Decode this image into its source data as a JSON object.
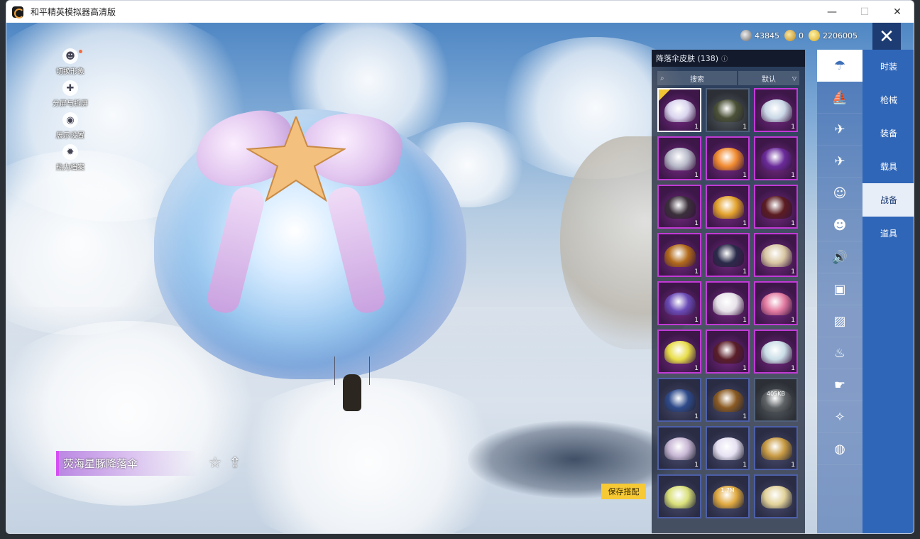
{
  "window": {
    "title": "和平精英模拟器高清版",
    "minimize": "—",
    "maximize": "☐",
    "close": "✕"
  },
  "left_tools": [
    {
      "label": "切换形象",
      "icon": "☻"
    },
    {
      "label": "分屏与拆屏",
      "icon": "✚"
    },
    {
      "label": "展示设置",
      "icon": "◉"
    },
    {
      "label": "热力档案",
      "icon": "✹"
    }
  ],
  "item_name": "荧海星豚降落伞",
  "save_label": "保存搭配",
  "currency": [
    {
      "name": "silver",
      "value": "43845"
    },
    {
      "name": "coupon",
      "value": "0"
    },
    {
      "name": "gold",
      "value": "2206005"
    }
  ],
  "panel": {
    "title": "降落伞皮肤 (138)",
    "search_label": "搜索",
    "sort_label": "默认",
    "items": [
      {
        "count": "1",
        "tone": "purple",
        "color": "#d9d4ee",
        "selected": true
      },
      {
        "count": "1",
        "tone": "dark",
        "color": "#4b5137"
      },
      {
        "count": "1",
        "tone": "purple",
        "color": "#c9d7e6"
      },
      {
        "count": "1",
        "tone": "purple",
        "color": "#b7b9c8"
      },
      {
        "count": "1",
        "tone": "purple",
        "color": "#f08a2e"
      },
      {
        "count": "1",
        "tone": "purple",
        "color": "#6a2b9a"
      },
      {
        "count": "1",
        "tone": "purple",
        "color": "#3a2f3a"
      },
      {
        "count": "1",
        "tone": "purple",
        "color": "#e2a12b"
      },
      {
        "count": "1",
        "tone": "purple",
        "color": "#5b1c20"
      },
      {
        "count": "1",
        "tone": "purple",
        "color": "#b26a1a"
      },
      {
        "count": "1",
        "tone": "purple",
        "color": "#2a2a4a"
      },
      {
        "count": "1",
        "tone": "purple",
        "color": "#d8c6a2"
      },
      {
        "count": "1",
        "tone": "purple",
        "color": "#6a4bb6"
      },
      {
        "count": "1",
        "tone": "purple",
        "color": "#e7e2e9"
      },
      {
        "count": "1",
        "tone": "purple",
        "color": "#e27aa0"
      },
      {
        "count": "1",
        "tone": "purple",
        "color": "#e8dd4a"
      },
      {
        "count": "1",
        "tone": "purple",
        "color": "#5a1e28"
      },
      {
        "count": "1",
        "tone": "purple",
        "color": "#c9dde6"
      },
      {
        "count": "1",
        "tone": "blue",
        "color": "#2e4a8a"
      },
      {
        "count": "1",
        "tone": "blue",
        "color": "#8a5a22"
      },
      {
        "count": "",
        "tone": "dark",
        "color": "#5f6366",
        "download": "405KB"
      },
      {
        "count": "1",
        "tone": "blue",
        "color": "#c7b7d4"
      },
      {
        "count": "1",
        "tone": "blue",
        "color": "#e6e1f2"
      },
      {
        "count": "1",
        "tone": "blue",
        "color": "#c89a42"
      },
      {
        "count": "",
        "tone": "blue",
        "color": "#d9e07a"
      },
      {
        "count": "",
        "tone": "blue",
        "color": "#e0a940",
        "download": "1.7M"
      },
      {
        "count": "",
        "tone": "blue",
        "color": "#e2d29a"
      }
    ]
  },
  "categories": [
    {
      "icon": "☂",
      "active": true
    },
    {
      "icon": "⛵"
    },
    {
      "icon": "✈"
    },
    {
      "icon": "✈"
    },
    {
      "icon": "☺"
    },
    {
      "icon": "☻"
    },
    {
      "icon": "🔊"
    },
    {
      "icon": "▣"
    },
    {
      "icon": "▨"
    },
    {
      "icon": "♨"
    },
    {
      "icon": "☛"
    },
    {
      "icon": "✧"
    },
    {
      "icon": "◍"
    }
  ],
  "main_tabs": [
    {
      "label": "时装"
    },
    {
      "label": "枪械"
    },
    {
      "label": "装备"
    },
    {
      "label": "载具"
    },
    {
      "label": "战备",
      "active": true
    },
    {
      "label": "道具"
    }
  ]
}
